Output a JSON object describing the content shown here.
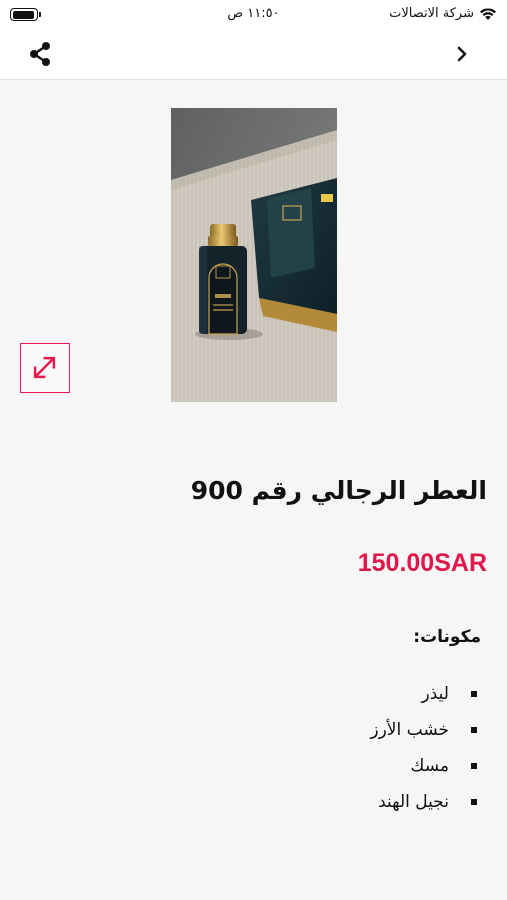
{
  "status_bar": {
    "carrier": "شركة الاتصالات",
    "time": "١١:٥٠ ص",
    "battery_level": 0.95
  },
  "nav": {
    "share_icon": "share-icon",
    "back_icon": "chevron-right-icon"
  },
  "product": {
    "image_subject": "perfume-bottle-photo",
    "title": "العطر الرجالي رقم 900",
    "price": "150.00SAR"
  },
  "ingredients": {
    "heading": "مكونات:",
    "items": [
      "ليذر",
      "خشب الأرز",
      "مسك",
      "نجيل الهند"
    ]
  },
  "colors": {
    "accent": "#e0184a",
    "background": "#f6f6f6"
  }
}
